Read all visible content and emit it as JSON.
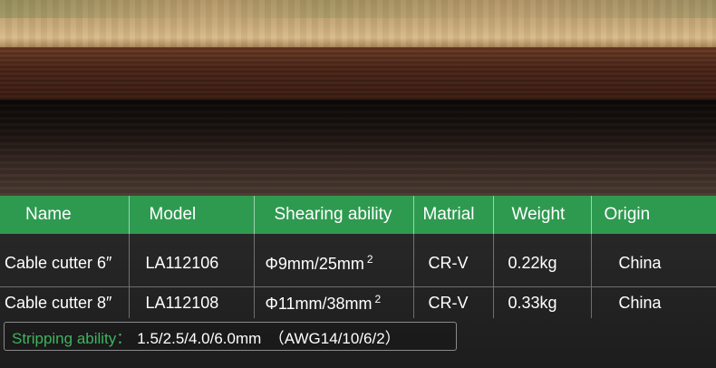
{
  "spec_table": {
    "headers": [
      "Name",
      "Model",
      "Shearing ability",
      "Matrial",
      "Weight",
      "Origin"
    ],
    "rows": [
      {
        "name": "Cable cutter 6″",
        "model": "LA112106",
        "shearing": "Φ9mm/25mm",
        "shearing_sup": "2",
        "material": "CR-V",
        "weight": "0.22kg",
        "origin": "China"
      },
      {
        "name": "Cable cutter 8″",
        "model": "LA112108",
        "shearing": "Φ11mm/38mm",
        "shearing_sup": "2",
        "material": "CR-V",
        "weight": "0.33kg",
        "origin": "China"
      }
    ]
  },
  "stripping": {
    "label": "Stripping ability：",
    "value": "1.5/2.5/4.0/6.0mm　（AWG14/10/6/2）"
  },
  "colors": {
    "header_green": "#2e9a50",
    "label_green": "#3fb35f"
  }
}
